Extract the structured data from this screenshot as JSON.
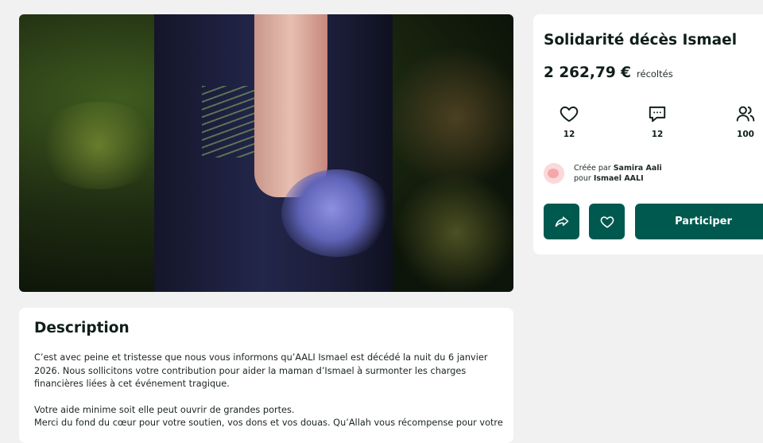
{
  "campaign": {
    "title": "Solidarité décès Ismael",
    "amount": "2 262,79 €",
    "amount_suffix": "récoltés",
    "stats": {
      "likes": "12",
      "comments": "12",
      "participants": "100"
    },
    "creator": {
      "created_by_prefix": "Créée par",
      "created_by": "Samira Aali",
      "for_prefix": "pour",
      "for": "Ismael AALI"
    },
    "buttons": {
      "participate": "Participer",
      "share_icon": "share-icon",
      "like_icon": "heart-icon"
    },
    "accent_color": "#00594f"
  },
  "description": {
    "title": "Description",
    "paragraph1": "C’est avec peine et tristesse que nous vous informons qu’AALI Ismael est décédé la nuit du 6 janvier 2026. Nous sollicitons votre contribution pour aider la maman d’Ismael à surmonter les charges financières liées à cet événement tragique.",
    "paragraph2": "Votre aide minime soit elle peut ouvrir de grandes portes.",
    "paragraph3": "Merci du fond du cœur pour votre soutien, vos dons et vos douas. Qu’Allah vous récompense pour votre"
  }
}
